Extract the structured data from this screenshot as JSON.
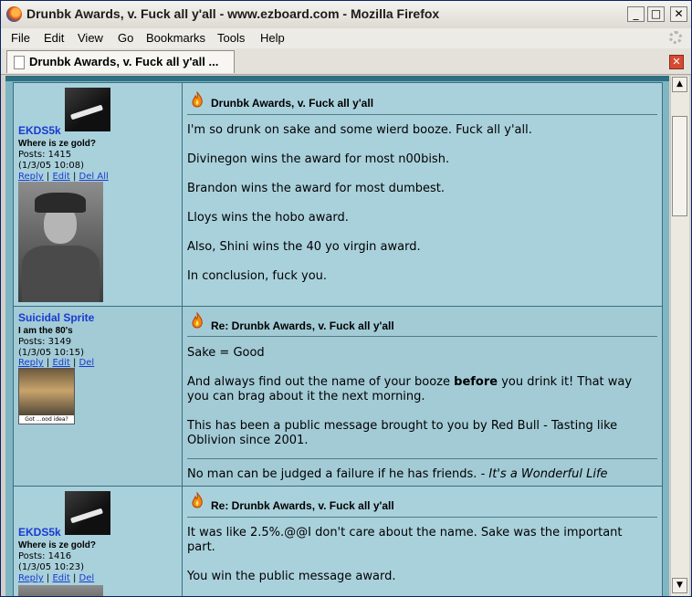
{
  "window": {
    "title": "Drunbk Awards, v. Fuck all y'all - www.ezboard.com - Mozilla Firefox",
    "minimize": "_",
    "maximize": "□",
    "close": "✕"
  },
  "menu": [
    "File",
    "Edit",
    "View",
    "Go",
    "Bookmarks",
    "Tools",
    "Help"
  ],
  "tab": {
    "label": "Drunbk Awards, v. Fuck all y'all ...",
    "close": "✕"
  },
  "scrollbar": {
    "up": "▲",
    "down": "▼"
  },
  "posts": [
    {
      "author": "EKDS5k",
      "user_title": "Where is ze gold?",
      "posts": "Posts: 1415",
      "date": "(1/3/05 10:08)",
      "links": [
        "Reply",
        "Edit",
        "Del All"
      ],
      "subject": "Drunbk Awards, v. Fuck all y'all",
      "body": [
        "I'm so drunk on sake and some wierd booze. Fuck all y'all.",
        "Divinegon wins the award for most n00bish.",
        "Brandon wins the award for most dumbest.",
        "Lloys wins the hobo award.",
        "Also, Shini wins the 40 yo virgin award.",
        "In conclusion, fuck you."
      ]
    },
    {
      "author": "Suicidal Sprite",
      "user_title": "I am the 80's",
      "posts": "Posts: 3149",
      "date": "(1/3/05 10:15)",
      "links": [
        "Reply",
        "Edit",
        "Del"
      ],
      "avatar_caption": "Got ...ood idea?",
      "subject": "Re: Drunbk Awards, v. Fuck all y'all",
      "body": [
        "Sake = Good"
      ],
      "body2_pre": "And always find out the name of your booze ",
      "body2_bold": "before",
      "body2_post": " you drink it! That way you can brag about it the next morning.",
      "body3": "This has been a public message brought to you by Red Bull - Tasting like Oblivion since 2001.",
      "signature_text": "No man can be judged a failure if he has friends. - ",
      "signature_italic": "It's a Wonderful Life"
    },
    {
      "author": "EKDS5k",
      "user_title": "Where is ze gold?",
      "posts": "Posts: 1416",
      "date": "(1/3/05 10:23)",
      "links": [
        "Reply",
        "Edit",
        "Del"
      ],
      "subject": "Re: Drunbk Awards, v. Fuck all y'all",
      "body": [
        "It was like 2.5%.@@I don't care about the name. Sake was the important part.",
        "You win the public message award."
      ]
    }
  ],
  "colors": {
    "post_bg": "#a9d1dc",
    "border": "#3a6f80",
    "username": "#1a3ad1"
  }
}
